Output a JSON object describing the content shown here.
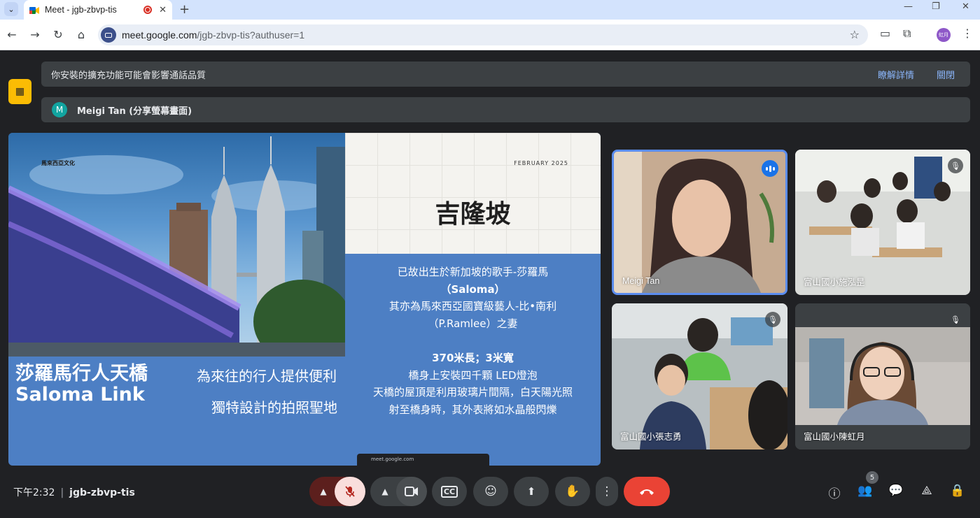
{
  "browser": {
    "tab_title": "Meet - jgb-zbvp-tis",
    "url_host": "meet.google.com",
    "url_path": "/jgb-zbvp-tis?authuser=1",
    "profile_initials": "虹月"
  },
  "banners": {
    "extension_warning": "你安裝的擴充功能可能會影響通話品質",
    "learn_more": "瞭解詳情",
    "close": "關閉",
    "presenter_initial": "M",
    "presenter_text": "Meigi Tan (分享螢幕畫面)"
  },
  "slide": {
    "small_label": "馬來西亞文化",
    "date": "FEBRUARY 2025",
    "title": "吉隆坡",
    "body_line1": "已故出生於新加坡的歌手-莎羅馬",
    "body_line2": "（Saloma）",
    "body_line3": "其亦為馬來西亞國寶級藝人-比•南利",
    "body_line4": "（P.Ramlee）之妻",
    "body_line5": "370米長；3米寬",
    "body_line6": "橋身上安裝四千顆 LED燈泡",
    "body_line7": "天橋的屋頂是利用玻璃片間隔，白天陽光照",
    "body_line8": "射至橋身時，其外表將如水晶般閃爍",
    "big_title_line1": "莎羅馬行人天橋",
    "big_title_line2": "Saloma Link",
    "sub1": "為來往的行人提供便利",
    "sub2": "獨特設計的拍照聖地",
    "share_bar": "meet.google.com"
  },
  "participants": [
    {
      "name": "Meigi Tan",
      "speaking": true
    },
    {
      "name": "富山國小施泓昰",
      "muted": true
    },
    {
      "name": "富山國小張志勇",
      "muted": true
    },
    {
      "name": "富山國小陳虹月",
      "muted": true
    }
  ],
  "bottom": {
    "time": "下午2:32",
    "meeting_code": "jgb-zbvp-tis",
    "people_count": "5"
  },
  "colors": {
    "accent": "#1a73e8",
    "end_call": "#ea4335",
    "mic_muted_bg": "#f9dedc",
    "warning": "#fbbc04"
  }
}
